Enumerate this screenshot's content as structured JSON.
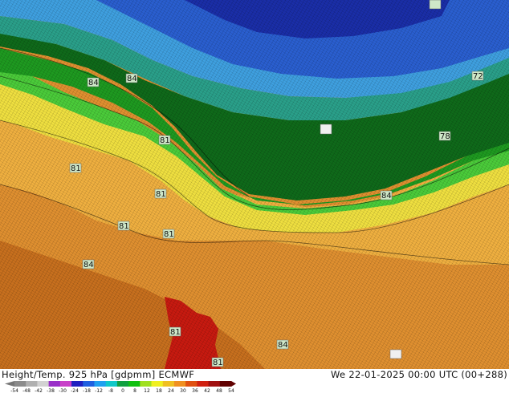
{
  "header": {
    "title_left": "Height/Temp. 925 hPa [gdpmm] ECMWF",
    "title_right": "We 22-01-2025 00:00 UTC (00+288)"
  },
  "colors": {
    "deep_blue": "#1a2ea8",
    "blue": "#2a5fd0",
    "light_blue": "#3fa0e0",
    "cyan": "#3ec8d8",
    "teal": "#2aa08a",
    "dark_green": "#0f6a1a",
    "green": "#1e9a20",
    "light_green": "#4bcc3a",
    "yellow": "#f0e040",
    "light_orange": "#f0b040",
    "orange": "#e09030",
    "dark_orange": "#c8701e",
    "red": "#c81a10"
  },
  "contour_labels": [
    "84",
    "84",
    "72",
    "81",
    "78",
    "81",
    "81",
    "84",
    "81",
    "81",
    "84",
    "81",
    "81",
    "84"
  ],
  "colorbar": {
    "ticks": [
      "-54",
      "-48",
      "-42",
      "-38",
      "-30",
      "-24",
      "-18",
      "-12",
      "-8",
      "0",
      "8",
      "12",
      "18",
      "24",
      "30",
      "36",
      "42",
      "48",
      "54"
    ],
    "colors": [
      "#8c8c8c",
      "#b0b0b0",
      "#d2d2d2",
      "#9a30c8",
      "#c840c8",
      "#2020c0",
      "#2060e0",
      "#20a0f0",
      "#10c8c8",
      "#10a040",
      "#10c010",
      "#a0e020",
      "#f0f020",
      "#f0c020",
      "#f09020",
      "#e05010",
      "#d02010",
      "#a01010",
      "#600000"
    ]
  }
}
